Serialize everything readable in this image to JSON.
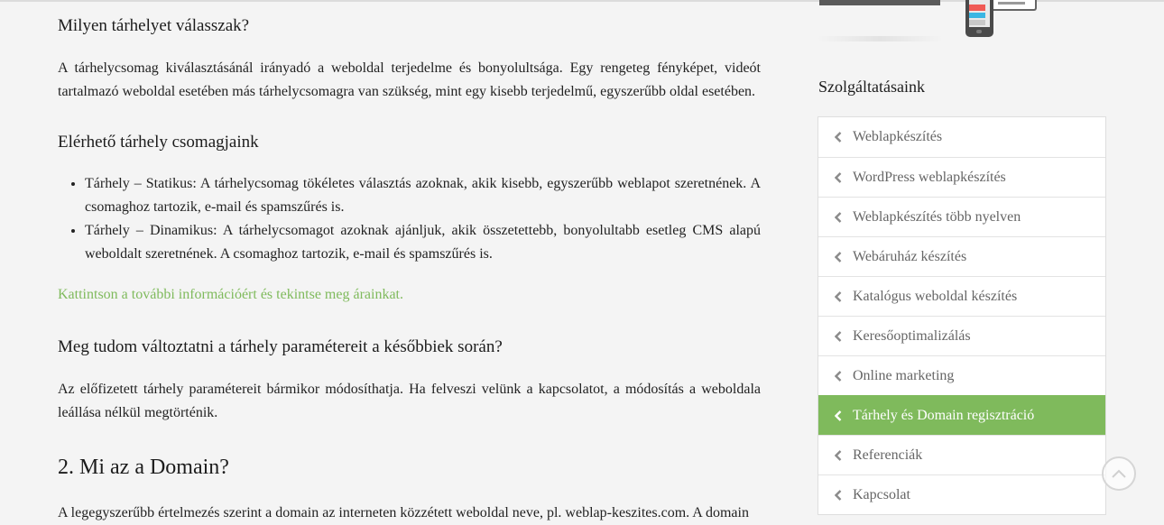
{
  "article": {
    "q1_title": "Milyen tárhelyet válasszak?",
    "q1_text": "A tárhelycsomag kiválasztásánál irányadó a weboldal terjedelme és bonyolultsága. Egy rengeteg fényképet, videót tartalmazó weboldal esetében más tárhelycsomagra van szükség, mint egy kisebb terjedelmű, egyszerűbb oldal esetében.",
    "packages_title": "Elérhető tárhely csomagjaink",
    "packages": [
      "Tárhely – Statikus: A tárhelycsomag tökéletes választás azoknak, akik kisebb, egyszerűbb weblapot szeretnének. A csomaghoz tartozik, e-mail és spamszűrés is.",
      "Tárhely – Dinamikus: A tárhelycsomagot azoknak ajánljuk, akik összetettebb, bonyolultabb esetleg CMS alapú weboldalt szeretnének. A csomaghoz tartozik, e-mail és spamszűrés is."
    ],
    "more_link": "Kattintson a további információért és tekintse meg árainkat.",
    "q2_title": "Meg tudom változtatni a tárhely paramétereit a későbbiek során?",
    "q2_text": "Az előfizetett tárhely paramétereit bármikor módosíthatja. Ha felveszi velünk a kapcsolatot, a módosítás a weboldala leállása nélkül megtörténik.",
    "domain_title": "2. Mi az a Domain?",
    "domain_text": "A legegyszerűbb értelmezés szerint a domain az interneten közzétett weboldal neve, pl. weblap-keszites.com. A domain"
  },
  "sidebar": {
    "title": "Szolgáltatásaink",
    "items": [
      {
        "label": "Weblapkészítés",
        "active": false
      },
      {
        "label": "WordPress weblapkészítés",
        "active": false
      },
      {
        "label": "Weblapkészítés több nyelven",
        "active": false
      },
      {
        "label": "Webáruház készítés",
        "active": false
      },
      {
        "label": "Katalógus weboldal készítés",
        "active": false
      },
      {
        "label": "Keresőoptimalizálás",
        "active": false
      },
      {
        "label": "Online marketing",
        "active": false
      },
      {
        "label": "Tárhely és Domain regisztráció",
        "active": true
      },
      {
        "label": "Referenciák",
        "active": false
      },
      {
        "label": "Kapcsolat",
        "active": false
      }
    ]
  },
  "colors": {
    "accent": "#7fba5c",
    "background": "#f4f4f4"
  },
  "icons": {
    "menu_item": "chevron-left-icon",
    "scroll_top": "chevron-up-icon"
  }
}
